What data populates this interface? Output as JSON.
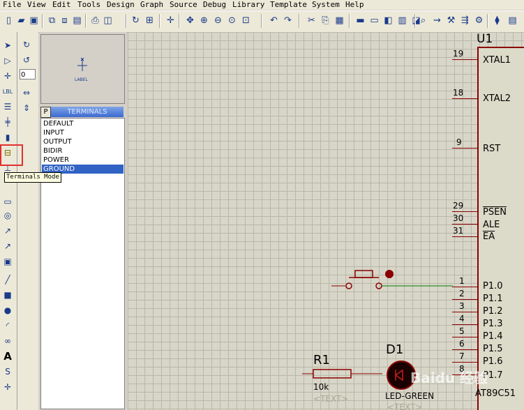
{
  "menu": [
    "File",
    "View",
    "Edit",
    "Tools",
    "Design",
    "Graph",
    "Source",
    "Debug",
    "Library",
    "Template",
    "System",
    "Help"
  ],
  "panel": {
    "preview_label": "LABEL",
    "toggle": "P",
    "title": "TERMINALS",
    "items": [
      "DEFAULT",
      "INPUT",
      "OUTPUT",
      "BIDIR",
      "POWER",
      "GROUND"
    ],
    "selected": "GROUND"
  },
  "left_tools": {
    "lbl_text": "LBL",
    "angle_value": "0"
  },
  "tooltip": "Terminals Mode",
  "schematic": {
    "chip": {
      "ref": "U1",
      "part": "AT89C51",
      "pins": [
        {
          "num": "19",
          "name": "XTAL1"
        },
        {
          "num": "18",
          "name": "XTAL2"
        },
        {
          "num": "9",
          "name": "RST"
        },
        {
          "num": "29",
          "name": "PSEN"
        },
        {
          "num": "30",
          "name": "ALE"
        },
        {
          "num": "31",
          "name": "EA"
        },
        {
          "num": "1",
          "name": "P1.0"
        },
        {
          "num": "2",
          "name": "P1.1"
        },
        {
          "num": "3",
          "name": "P1.2"
        },
        {
          "num": "4",
          "name": "P1.3"
        },
        {
          "num": "5",
          "name": "P1.4"
        },
        {
          "num": "6",
          "name": "P1.5"
        },
        {
          "num": "7",
          "name": "P1.6"
        },
        {
          "num": "8",
          "name": "P1.7"
        }
      ]
    },
    "resistor": {
      "ref": "R1",
      "value": "10k",
      "text": "<TEXT>"
    },
    "led": {
      "ref": "D1",
      "value": "LED-GREEN",
      "text": "<TEXT>"
    }
  },
  "watermark": "Baidu 经验"
}
